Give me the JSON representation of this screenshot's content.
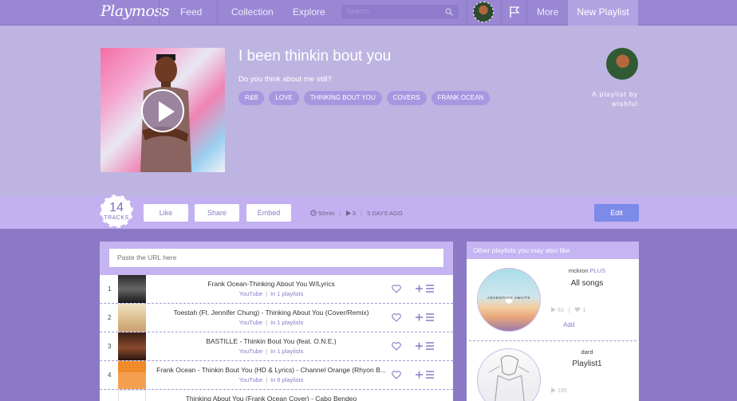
{
  "nav": {
    "logo": "Playmoss",
    "links": [
      "Feed",
      "Collection",
      "Explore"
    ],
    "search_placeholder": "Search",
    "more": "More",
    "new_playlist": "New Playlist"
  },
  "playlist": {
    "title": "I been thinkin bout you",
    "description": "Do you think about me still?",
    "tags": [
      "R&B",
      "LOVE",
      "THINKING BOUT YOU",
      "COVERS",
      "FRANK OCEAN"
    ],
    "byline": "A playlist by",
    "owner": "wishful"
  },
  "actions": {
    "track_count": "14",
    "tracks_label": "TRACKS",
    "like": "Like",
    "share": "Share",
    "embed": "Embed",
    "duration": "50min",
    "plays": "3",
    "age": "5 DAYS AGO",
    "edit": "Edit"
  },
  "tracklist": {
    "url_placeholder": "Paste the URL here",
    "tracks": [
      {
        "num": "1",
        "title": "Frank Ocean-Thinking About You W/Lyrics",
        "source": "YouTube",
        "in_playlists": "In 1 playlists"
      },
      {
        "num": "2",
        "title": "Toestah (Ft. Jennifer Chung) - Thinking About You (Cover/Remix)",
        "source": "YouTube",
        "in_playlists": "In 1 playlists"
      },
      {
        "num": "3",
        "title": "BASTILLE - Thinkin Bout You (feat. O.N.E.)",
        "source": "YouTube",
        "in_playlists": "In 1 playlists"
      },
      {
        "num": "4",
        "title": "Frank Ocean - Thinkin Bout You (HD & Lyrics) - Channel Orange (Rhyon B...",
        "source": "YouTube",
        "in_playlists": "In 6 playlists"
      },
      {
        "num": "",
        "title": "Thinking About You (Frank Ocean Cover) - Cabo Bendeo",
        "source": "",
        "in_playlists": ""
      }
    ]
  },
  "sidebar": {
    "heading": "Other playlists you may also like",
    "items": [
      {
        "user": "mckron",
        "badge": "PLUS",
        "name": "All songs",
        "plays": "63",
        "likes": "1",
        "add": "Add",
        "disc_text": "ADVENTURE AWAITS"
      },
      {
        "user": "dard",
        "name": "Playlist1",
        "plays": "199"
      }
    ]
  },
  "colors": {
    "accent": "#8b79c6",
    "hero_bg": "#beb4e2",
    "action_bar": "#c3b0f0",
    "edit_button": "#7c8ae8"
  }
}
